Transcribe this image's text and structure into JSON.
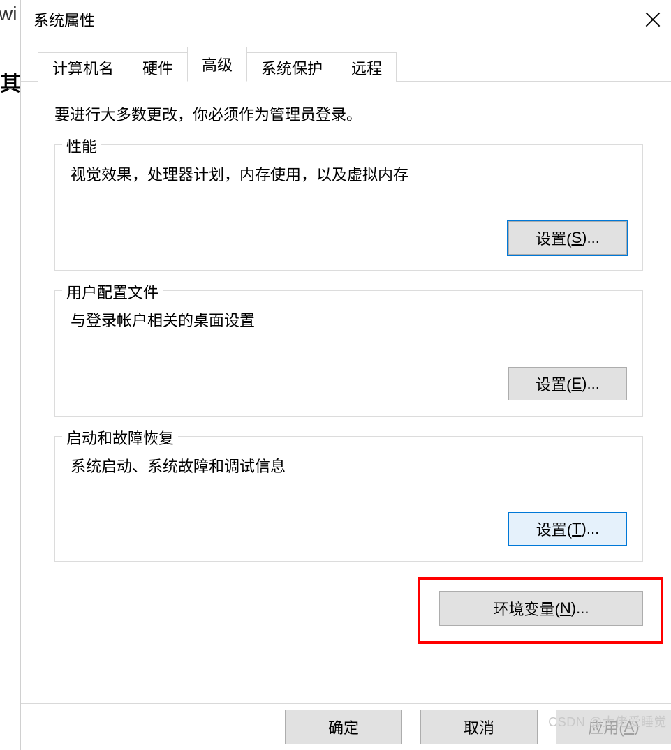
{
  "background": {
    "text1": "wi",
    "text2": "其"
  },
  "dialog": {
    "title": "系统属性"
  },
  "tabs": {
    "items": [
      {
        "label": "计算机名",
        "active": false
      },
      {
        "label": "硬件",
        "active": false
      },
      {
        "label": "高级",
        "active": true
      },
      {
        "label": "系统保护",
        "active": false
      },
      {
        "label": "远程",
        "active": false
      }
    ]
  },
  "body": {
    "intro": "要进行大多数更改，你必须作为管理员登录。",
    "groups": {
      "perf": {
        "title": "性能",
        "desc": "视觉效果，处理器计划，内存使用，以及虚拟内存",
        "button_pre": "设置(",
        "button_u": "S",
        "button_post": ")..."
      },
      "profile": {
        "title": "用户配置文件",
        "desc": "与登录帐户相关的桌面设置",
        "button_pre": "设置(",
        "button_u": "E",
        "button_post": ")..."
      },
      "startup": {
        "title": "启动和故障恢复",
        "desc": "系统启动、系统故障和调试信息",
        "button_pre": "设置(",
        "button_u": "T",
        "button_post": ")..."
      }
    },
    "env": {
      "button_pre": "环境变量(",
      "button_u": "N",
      "button_post": ")..."
    }
  },
  "footer": {
    "ok": "确定",
    "cancel": "取消",
    "apply_pre": "应用(",
    "apply_u": "A",
    "apply_post": ")"
  },
  "watermark": "CSDN @大佬爱睡觉"
}
